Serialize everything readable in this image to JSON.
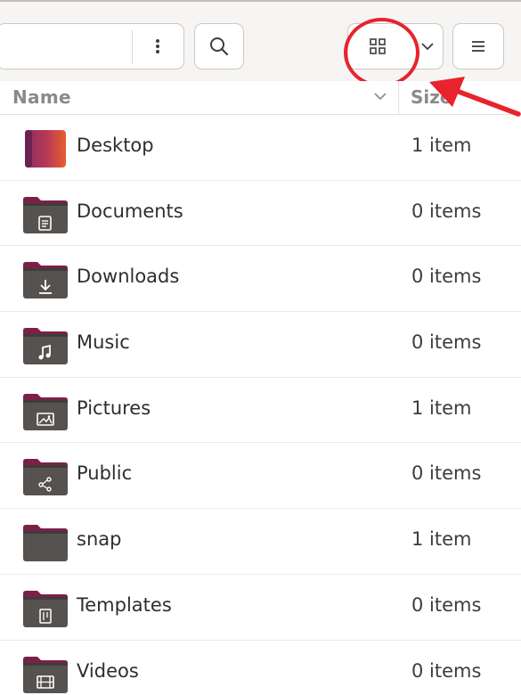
{
  "toolbar": {
    "icons": {
      "path_menu": "vertical-ellipsis-icon",
      "search": "search-icon",
      "view": "grid-view-icon",
      "view_dropdown": "chevron-down-icon",
      "main_menu": "hamburger-menu-icon"
    }
  },
  "header": {
    "name_label": "Name",
    "size_label": "Size"
  },
  "annotation": {
    "color": "#e8232c"
  },
  "files": [
    {
      "name": "Desktop",
      "size": "1 item",
      "icon": "desktop-folder-icon"
    },
    {
      "name": "Documents",
      "size": "0 items",
      "icon": "documents-folder-icon"
    },
    {
      "name": "Downloads",
      "size": "0 items",
      "icon": "downloads-folder-icon"
    },
    {
      "name": "Music",
      "size": "0 items",
      "icon": "music-folder-icon"
    },
    {
      "name": "Pictures",
      "size": "1 item",
      "icon": "pictures-folder-icon"
    },
    {
      "name": "Public",
      "size": "0 items",
      "icon": "public-folder-icon"
    },
    {
      "name": "snap",
      "size": "1 item",
      "icon": "folder-icon"
    },
    {
      "name": "Templates",
      "size": "0 items",
      "icon": "templates-folder-icon"
    },
    {
      "name": "Videos",
      "size": "0 items",
      "icon": "videos-folder-icon"
    }
  ]
}
